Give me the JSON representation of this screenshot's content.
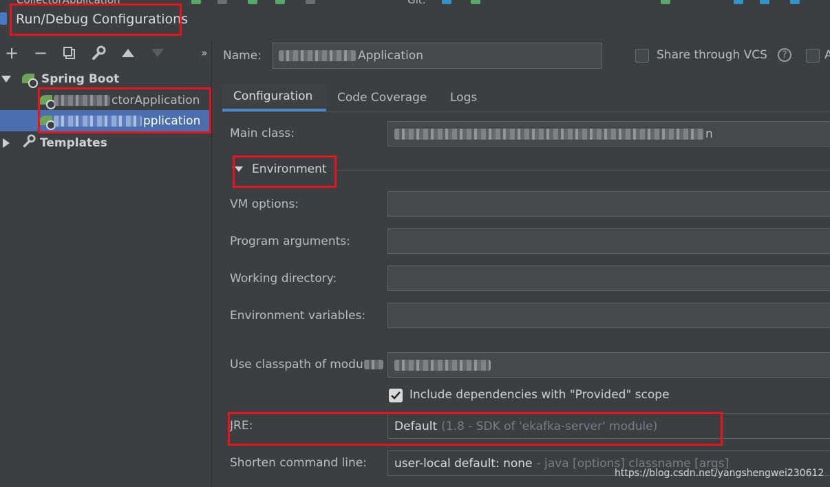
{
  "top_strip": {
    "config_fragment": "CollectorApplication",
    "git_label": "Git:"
  },
  "dialog": {
    "title": "Run/Debug Configurations"
  },
  "tree": {
    "toolbar": {
      "add": "+",
      "remove": "−",
      "more": "»"
    },
    "groups": [
      {
        "label": "Spring Boot",
        "expanded": true,
        "items": [
          {
            "label": "ctorApplication",
            "selected": false
          },
          {
            "label": "pplication",
            "selected": true
          }
        ]
      },
      {
        "label": "Templates",
        "expanded": false
      }
    ]
  },
  "header": {
    "name_label": "Name:",
    "name_value": "Application",
    "share_label": "Share through VCS",
    "help_icon": "?",
    "extra_checkbox_fragment": "A"
  },
  "tabs": [
    {
      "label": "Configuration",
      "active": true
    },
    {
      "label": "Code Coverage",
      "active": false
    },
    {
      "label": "Logs",
      "active": false
    }
  ],
  "form": {
    "main_class_label": "Main class:",
    "main_class_value_tail": "n",
    "environment_label": "Environment",
    "vm_options_label": "VM options:",
    "program_arguments_label": "Program arguments:",
    "working_directory_label": "Working directory:",
    "environment_variables_label": "Environment variables:",
    "classpath_label": "Use classpath of modu",
    "include_deps_label": "Include dependencies with \"Provided\" scope",
    "include_deps_checked": true,
    "jre_label": "JRE:",
    "jre_value": "Default",
    "jre_hint": "(1.8 - SDK of 'ekafka-server' module)",
    "shorten_label": "Shorten command line:",
    "shorten_value": "user-local default: none",
    "shorten_hint": "- java [options] classname [args]"
  },
  "watermark": "https://blog.csdn.net/yangshengwei230612",
  "colors": {
    "highlight_red": "#e8141b",
    "selection_blue": "#4b6eaf",
    "spring_green": "#6ca55a",
    "tab_underline": "#4a88c7"
  }
}
